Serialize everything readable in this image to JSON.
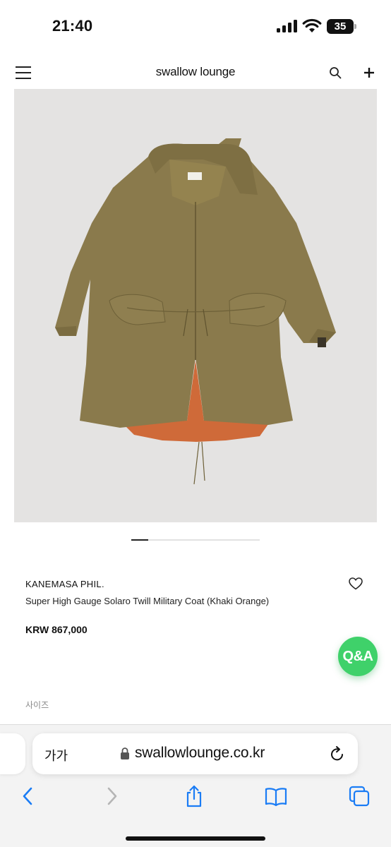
{
  "status_bar": {
    "time": "21:40",
    "battery": "35"
  },
  "header": {
    "brand": "swallow lounge"
  },
  "product": {
    "brand": "KANEMASA PHIL.",
    "title": "Super High Gauge Solaro Twill Military Coat (Khaki Orange)",
    "price": "KRW 867,000",
    "size_label": "사이즈"
  },
  "qa_button": {
    "label": "Q&A"
  },
  "browser": {
    "text_size": "가가",
    "url": "swallowlounge.co.kr"
  },
  "colors": {
    "coat": "#8a7a4c",
    "lining": "#d26a3a",
    "qa": "#3fd16a",
    "ios_blue": "#1a7cf5",
    "image_bg": "#e4e3e2"
  },
  "icons": [
    "menu-icon",
    "search-icon",
    "add-icon",
    "heart-icon",
    "lock-icon",
    "reload-icon",
    "back-icon",
    "forward-icon",
    "share-icon",
    "bookmarks-icon",
    "tabs-icon"
  ]
}
